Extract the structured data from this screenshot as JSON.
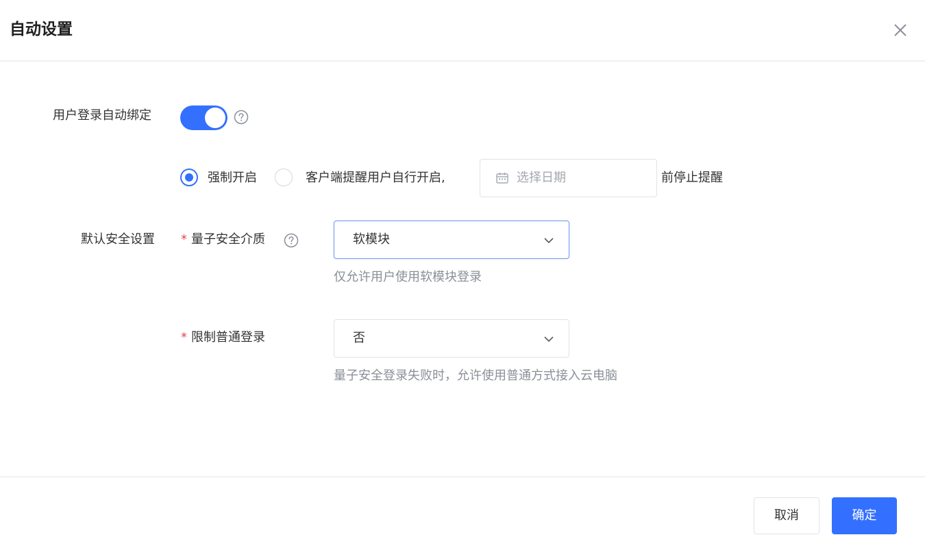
{
  "dialog": {
    "title": "自动设置",
    "close_icon": "close-icon"
  },
  "auto_bind": {
    "label": "用户登录自动绑定",
    "enabled": true,
    "help_icon": "question-circle-icon"
  },
  "enable_mode": {
    "options": [
      {
        "label": "强制开启",
        "checked": true
      },
      {
        "label": "客户端提醒用户自行开启,",
        "checked": false
      }
    ],
    "date_placeholder": "选择日期",
    "date_icon": "calendar-icon",
    "suffix": "前停止提醒"
  },
  "security": {
    "section_label": "默认安全设置",
    "required_mark": "*",
    "medium_label": "量子安全介质",
    "medium_help_icon": "question-circle-icon",
    "medium_value": "软模块",
    "medium_hint": "仅允许用户使用软模块登录",
    "restrict_label": "限制普通登录",
    "restrict_value": "否",
    "restrict_hint": "量子安全登录失败时，允许使用普通方式接入云电脑",
    "chevron_icon": "chevron-down-icon"
  },
  "footer": {
    "cancel_label": "取消",
    "ok_label": "确定"
  },
  "colors": {
    "primary": "#3370ff",
    "required": "#e5484d",
    "hint": "#8a8f98",
    "placeholder": "#a3a8b0"
  }
}
